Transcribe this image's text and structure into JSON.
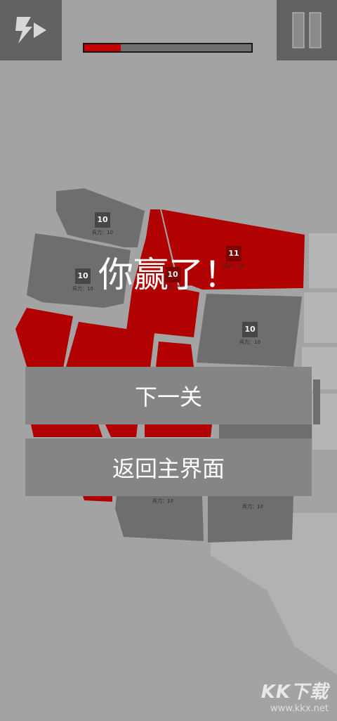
{
  "game": {
    "progress_fraction": 0.22,
    "win_title": "你赢了！",
    "next_level_label": "下一关",
    "main_menu_label": "返回主界面"
  },
  "controls": {
    "speed_icon": "lightning-fast-forward-icon",
    "pause_icon": "pause-icon"
  },
  "regions": [
    {
      "id": "washington",
      "owner": "neutral",
      "troops": "10",
      "sub": "兵力：10"
    },
    {
      "id": "montana",
      "owner": "player",
      "troops": "11",
      "sub": "兵力：25"
    },
    {
      "id": "oregon",
      "owner": "neutral",
      "troops": "10",
      "sub": "兵力：10"
    },
    {
      "id": "idaho",
      "owner": "player",
      "troops": "10",
      "sub": "兵力：10"
    },
    {
      "id": "wyoming",
      "owner": "neutral",
      "troops": "10",
      "sub": "兵力：10"
    },
    {
      "id": "arizona",
      "owner": "neutral",
      "troops": "",
      "sub": "兵力：10"
    },
    {
      "id": "new-mexico",
      "owner": "neutral",
      "troops": "",
      "sub": "兵力：10"
    }
  ],
  "colors": {
    "player": "#b00000",
    "neutral": "#6e6e6e",
    "background": "#a3a3a3",
    "progress_fill": "#c40000"
  },
  "watermark": {
    "logo": "KK下载",
    "url": "www.kkx.net"
  }
}
